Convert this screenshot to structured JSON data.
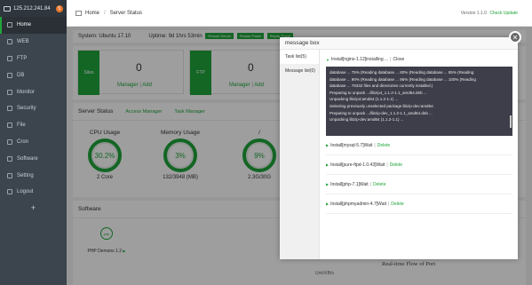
{
  "sidebar": {
    "ip": "125.212.241.84",
    "badge": "5",
    "items": [
      {
        "label": "Home",
        "active": true
      },
      {
        "label": "WEB"
      },
      {
        "label": "FTP"
      },
      {
        "label": "DB"
      },
      {
        "label": "Monitor"
      },
      {
        "label": "Security"
      },
      {
        "label": "File"
      },
      {
        "label": "Cron"
      },
      {
        "label": "Software"
      },
      {
        "label": "Setting"
      },
      {
        "label": "Logout"
      }
    ],
    "add_label": "+"
  },
  "header": {
    "breadcrumb": [
      "Home",
      "Server Status"
    ],
    "version": "Version 1.1.0",
    "check_update": "Check Update"
  },
  "sysbar": {
    "system": "System: Ubuntu 17.10",
    "uptime": "Uptime: 9d 1hrs 53min",
    "buttons": [
      "Restart Server",
      "Restart Panel",
      "Repair Panel"
    ]
  },
  "cards": [
    {
      "name": "Sites",
      "count": "0",
      "manager": "Manager",
      "sep": "|",
      "add": "Add"
    },
    {
      "name": "FTP",
      "count": "0",
      "manager": "Manager",
      "sep": "|",
      "add": "Add"
    }
  ],
  "status": {
    "title": "Server Status",
    "links": [
      "Access Manager",
      "Task Manager"
    ],
    "gauges": [
      {
        "label": "CPU Usage",
        "value": "30.2%",
        "sub": "2 Core",
        "percent": 30.2
      },
      {
        "label": "Memory Usage",
        "value": "3%",
        "sub": "132/3948 (MB)",
        "percent": 3
      },
      {
        "label": "/",
        "value": "9%",
        "sub": "2.3G/30G",
        "percent": 9
      }
    ]
  },
  "software": {
    "title": "Software",
    "items": [
      {
        "name": "PHP Demons 1.2",
        "logo": "php"
      }
    ],
    "chart_caption": "Real-time Flow of Port",
    "unit": "Unit:KB/s"
  },
  "modal": {
    "title": "message box",
    "tabs": [
      "Task list(5)",
      "Message list(0)"
    ],
    "current_task": "Install[nginx-1.12]installing ...",
    "close_label": "Close",
    "console_lines": [
      "database ... 75% (Reading database ... 80% (Reading database ... 85% (Reading",
      "database ... 90% (Reading database ... 95% (Reading database ... 100% (Reading",
      "database ... 78332 files and directories currently installed.)",
      "Preparing to unpack .../libzip4_1.1.2-1.1_amd64.deb ...",
      "Unpacking libzip4:amd64 (1.1.2-1.1) ...",
      "Selecting previously unselected package libzip-dev:amd64.",
      "Preparing to unpack .../libzip-dev_1.1.2-1.1_amd64.deb ...",
      "Unpacking libzip-dev:amd64 (1.1.2-1.1) ..."
    ],
    "queue": [
      {
        "name": "Install[mysql-5.7]Wait",
        "sep": "|",
        "action": "Delete"
      },
      {
        "name": "Install[pure-ftpd-1.0.43]Wait",
        "sep": "|",
        "action": "Delete"
      },
      {
        "name": "Install[php-7.1]Wait",
        "sep": "|",
        "action": "Delete"
      },
      {
        "name": "Install[phpmyadmin-4.7]Wait",
        "sep": "|",
        "action": "Delete"
      }
    ]
  },
  "colors": {
    "accent": "#20a53a",
    "sidebar": "#3c444d",
    "console": "#3e3e4a"
  }
}
